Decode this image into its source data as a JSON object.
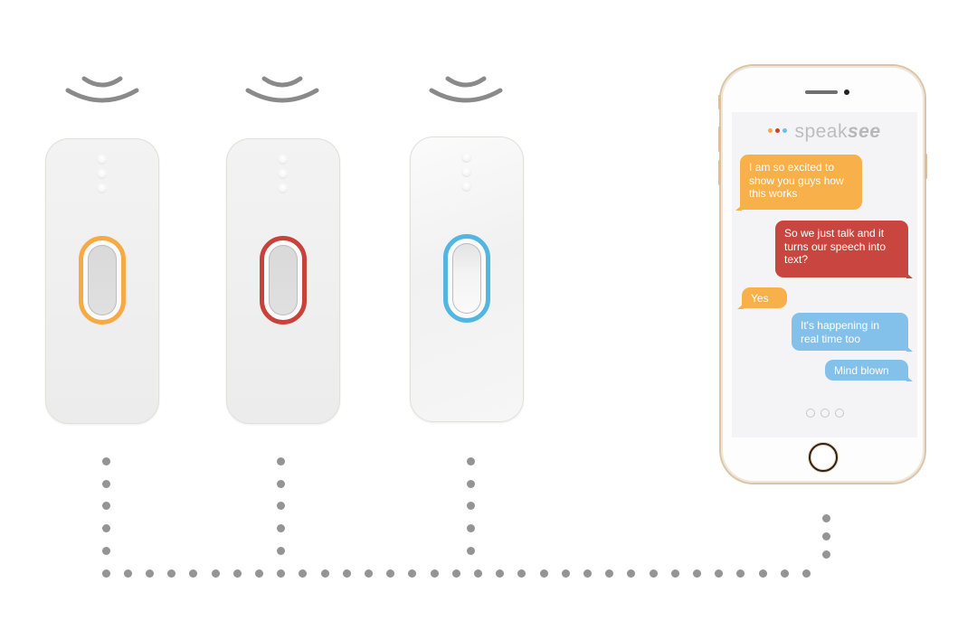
{
  "scene": {
    "description": "Three wireless microphone clips connected to a smartphone showing live speech-to-text chat",
    "colors": {
      "wave": "#8a8a8a",
      "connector_dots": "#949494",
      "orange": "#f5aa43",
      "red": "#c8423c",
      "blue": "#52b6e0",
      "bubble_blue": "#84c1ea",
      "phone_frame": "#dcc4a6"
    }
  },
  "devices": [
    {
      "name": "device-orange",
      "ring_color": "#f5aa43",
      "signal": "wireless-signal-icon"
    },
    {
      "name": "device-red",
      "ring_color": "#c8423c",
      "signal": "wireless-signal-icon"
    },
    {
      "name": "device-blue",
      "ring_color": "#52b6e0",
      "signal": "wireless-signal-icon"
    }
  ],
  "phone": {
    "app": {
      "logo_light": "speak",
      "logo_bold": "see",
      "logo_dots": [
        "#f5aa43",
        "#c8423c",
        "#63c2ec"
      ]
    },
    "messages": [
      {
        "side": "left",
        "color": "#f8b04a",
        "text": "I am so excited to show you guys how this works"
      },
      {
        "side": "right",
        "color": "#c8463f",
        "text": "So we just talk and it turns our speech into text?"
      },
      {
        "side": "left",
        "color": "#f8b04a",
        "text": "Yes"
      },
      {
        "side": "right",
        "color": "#84c1ea",
        "text": "It's happening in real time too"
      },
      {
        "side": "right",
        "color": "#84c1ea",
        "text": "Mind blown"
      }
    ],
    "typing_indicator_dots": 3
  }
}
